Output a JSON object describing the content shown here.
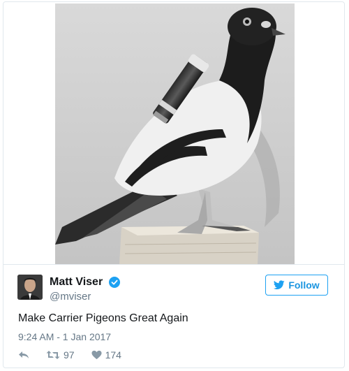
{
  "tweet": {
    "user": {
      "display_name": "Matt Viser",
      "handle": "@mviser",
      "verified_icon": "verified-badge-icon"
    },
    "follow_label": "Follow",
    "text": "Make Carrier Pigeons Great Again",
    "timestamp": "9:24 AM - 1 Jan 2017",
    "stats": {
      "retweets": "97",
      "likes": "174"
    },
    "icons": {
      "reply": "reply-icon",
      "retweet": "retweet-icon",
      "like": "heart-icon",
      "follow": "twitter-bird-icon"
    },
    "colors": {
      "accent": "#1da1f2",
      "text": "#14171a",
      "muted": "#657786",
      "border": "#e1e8ed"
    }
  }
}
